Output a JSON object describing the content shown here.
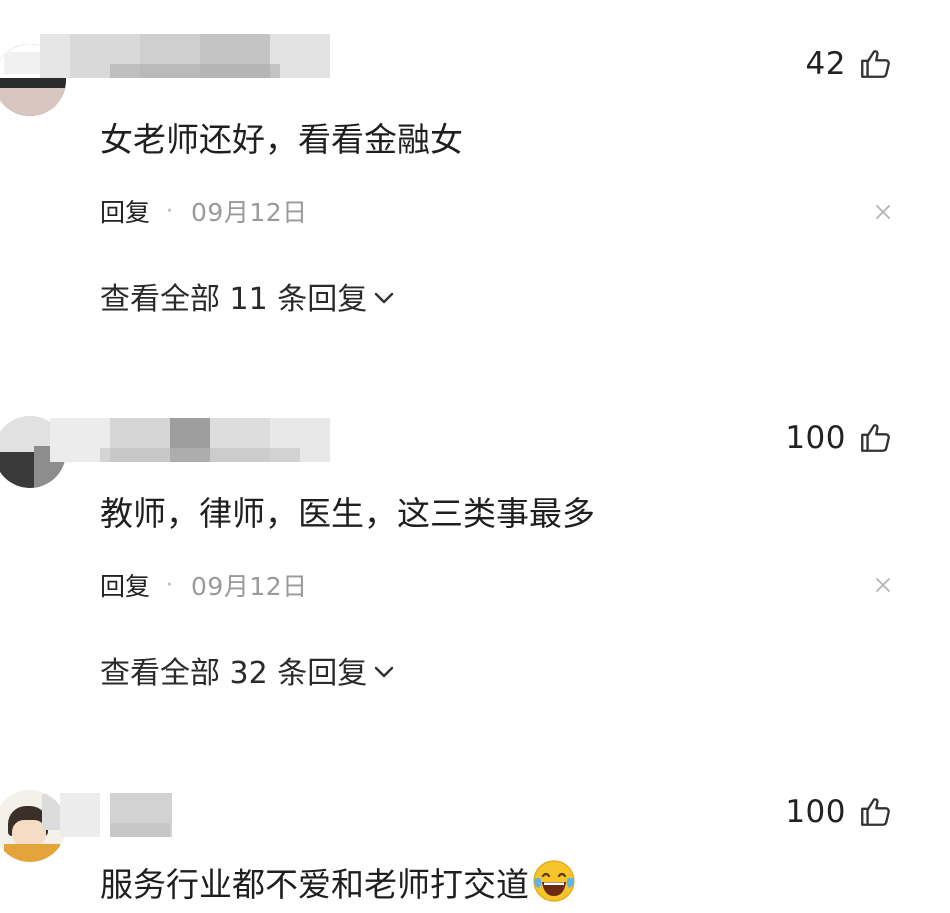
{
  "comments": [
    {
      "like_count": "42",
      "text": "女老师还好，看看金融女",
      "reply_label": "回复",
      "separator": "·",
      "date": "09月12日",
      "view_replies_label": "查看全部 11 条回复"
    },
    {
      "like_count": "100",
      "text": "教师，律师，医生，这三类事最多",
      "reply_label": "回复",
      "separator": "·",
      "date": "09月12日",
      "view_replies_label": "查看全部 32 条回复"
    },
    {
      "like_count": "100",
      "text": "服务行业都不爱和老师打交道",
      "emoji": "laughing-crying-emoji"
    }
  ],
  "icons": {
    "like": "thumbs-up-icon",
    "dismiss": "close-icon",
    "expand": "chevron-down-icon"
  },
  "colors": {
    "background": "#ffffff",
    "text": "#222222",
    "date": "#9a9a9a",
    "icon": "#333333",
    "dismiss_icon": "#b5b5b5"
  }
}
